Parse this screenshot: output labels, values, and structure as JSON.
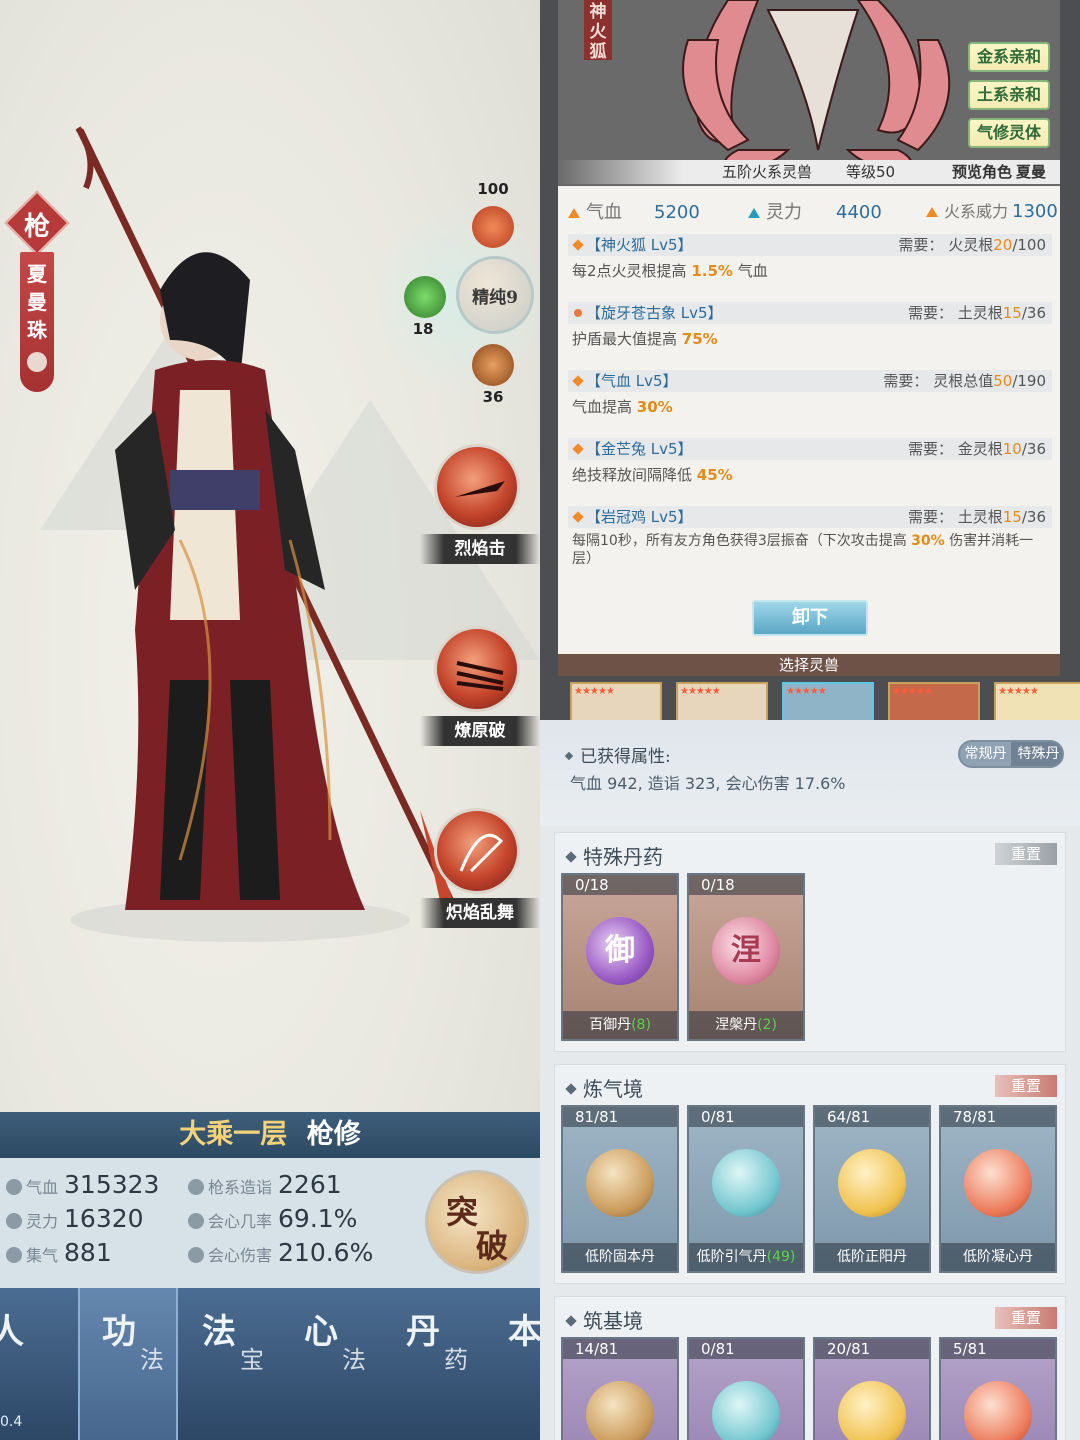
{
  "left": {
    "weapon_badge": "枪",
    "character_name_chars": [
      "夏",
      "曼",
      "珠"
    ],
    "element_stats": {
      "fire_value": "100",
      "wood_value": "18",
      "earth_value": "36",
      "purity": "精纯9"
    },
    "skills": [
      {
        "name": "烈焰击"
      },
      {
        "name": "燎原破"
      },
      {
        "name": "炽焰乱舞"
      }
    ],
    "realm_title": "大乘一层",
    "realm_class": "枪修",
    "stats": [
      {
        "label": "气血",
        "value": "315323"
      },
      {
        "label": "灵力",
        "value": "16320"
      },
      {
        "label": "集气",
        "value": "881"
      },
      {
        "label": "枪系造诣",
        "value": "2261"
      },
      {
        "label": "会心几率",
        "value": "69.1%"
      },
      {
        "label": "会心伤害",
        "value": "210.6%"
      }
    ],
    "breakthrough": {
      "char1": "突",
      "char2": "破"
    },
    "nav": [
      {
        "main": "功",
        "sub": "法"
      },
      {
        "main": "法",
        "sub": "宝"
      },
      {
        "main": "心",
        "sub": "法"
      },
      {
        "main": "丹",
        "sub": "药"
      },
      {
        "main": "本",
        "sub": ""
      }
    ],
    "nav_partial_left": "人",
    "version_fragment": "0.4"
  },
  "beast": {
    "name_vertical": "神火狐",
    "tags": [
      "金系亲和",
      "土系亲和",
      "气修灵体"
    ],
    "info_line": "五阶火系灵兽",
    "level": "等级50",
    "preview_label": "预览角色",
    "preview_name": "夏曼珠",
    "attrs": [
      {
        "label": "气血",
        "value": "5200"
      },
      {
        "label": "灵力",
        "value": "4400"
      },
      {
        "label": "火系威力",
        "value": "1300"
      }
    ],
    "skills": [
      {
        "name": "【神火狐 Lv5】",
        "req_label": "需要：",
        "req_root": "火灵根",
        "req_have": "20",
        "req_need": "/100",
        "desc_pre": "每2点火灵根提高 ",
        "desc_val": "1.5%",
        "desc_post": " 气血"
      },
      {
        "name": "【旋牙苍古象 Lv5】",
        "req_label": "需要：",
        "req_root": "土灵根",
        "req_have": "15",
        "req_need": "/36",
        "desc_pre": "护盾最大值提高 ",
        "desc_val": "75%",
        "desc_post": ""
      },
      {
        "name": "【气血 Lv5】",
        "req_label": "需要：",
        "req_root": "灵根总值",
        "req_have": "50",
        "req_need": "/190",
        "desc_pre": "气血提高 ",
        "desc_val": "30%",
        "desc_post": ""
      },
      {
        "name": "【金芒兔 Lv5】",
        "req_label": "需要：",
        "req_root": "金灵根",
        "req_have": "10",
        "req_need": "/36",
        "desc_pre": "绝技释放间隔降低 ",
        "desc_val": "45%",
        "desc_post": ""
      },
      {
        "name": "【岩冠鸡 Lv5】",
        "req_label": "需要：",
        "req_root": "土灵根",
        "req_have": "15",
        "req_need": "/36",
        "desc_pre": "每隔10秒，所有友方角色获得3层振奋（下次攻击提高 ",
        "desc_val": "30%",
        "desc_post": " 伤害并消耗一层）"
      }
    ],
    "unload_button": "卸下",
    "select_bar": "选择灵兽",
    "card_stars": "★★★★★"
  },
  "pills": {
    "acquired_title": "已获得属性:",
    "acquired_text": "气血 942, 造诣 323, 会心伤害 17.6%",
    "toggle": [
      "常规丹",
      "特殊丹"
    ],
    "sections": [
      {
        "title": "特殊丹药",
        "reset": "重置",
        "items": [
          {
            "count": "0/18",
            "name": "百御丹",
            "extra": "(8)",
            "glyph": "御"
          },
          {
            "count": "0/18",
            "name": "涅槃丹",
            "extra": "(2)",
            "glyph": "涅"
          }
        ]
      },
      {
        "title": "炼气境",
        "reset": "重置",
        "items": [
          {
            "count": "81/81",
            "name": "低阶固本丹",
            "extra": ""
          },
          {
            "count": "0/81",
            "name": "低阶引气丹",
            "extra": "(49)"
          },
          {
            "count": "64/81",
            "name": "低阶正阳丹",
            "extra": ""
          },
          {
            "count": "78/81",
            "name": "低阶凝心丹",
            "extra": ""
          }
        ]
      },
      {
        "title": "筑基境",
        "reset": "重置",
        "items": [
          {
            "count": "14/81"
          },
          {
            "count": "0/81"
          },
          {
            "count": "20/81"
          },
          {
            "count": "5/81"
          }
        ]
      }
    ]
  },
  "colors": {
    "accent_orange": "#e48c1b",
    "accent_blue": "#2f6e9a",
    "fire_red": "#c4442b"
  }
}
